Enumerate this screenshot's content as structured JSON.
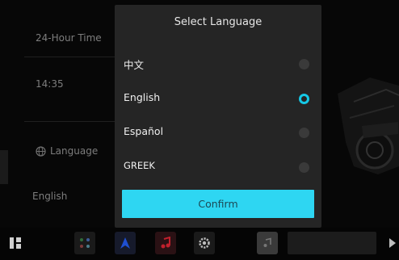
{
  "background": {
    "time_format_label": "24-Hour Time",
    "time_value": "14:35",
    "language_label": "Language",
    "language_value": "English"
  },
  "modal": {
    "title": "Select Language",
    "options": [
      {
        "label": "中文",
        "selected": false
      },
      {
        "label": "English",
        "selected": true
      },
      {
        "label": "Español",
        "selected": false
      },
      {
        "label": "GREEK",
        "selected": false
      }
    ],
    "confirm_label": "Confirm"
  },
  "dock": {
    "items": [
      "apps-grid-icon",
      "app-launcher-icon",
      "navigation-icon",
      "music-icon",
      "settings-icon",
      "album-art-icon"
    ]
  },
  "colors": {
    "accent": "#2ed6f2",
    "modal_bg": "#252525",
    "music_red": "#c0202c",
    "nav_blue": "#1f4fd0"
  }
}
